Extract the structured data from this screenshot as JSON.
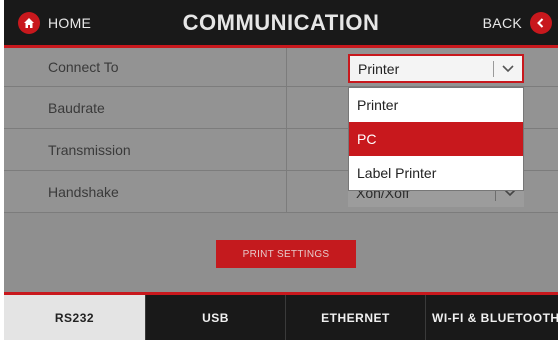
{
  "header": {
    "home_label": "HOME",
    "title": "COMMUNICATION",
    "back_label": "BACK"
  },
  "settings": [
    {
      "label": "Connect To",
      "value": "Printer"
    },
    {
      "label": "Baudrate",
      "value": ""
    },
    {
      "label": "Transmission",
      "value": ""
    },
    {
      "label": "Handshake",
      "value": "Xon/Xoff"
    }
  ],
  "dropdown": {
    "options": [
      "Printer",
      "PC",
      "Label Printer"
    ],
    "highlighted": "PC"
  },
  "print_settings_label": "PRINT SETTINGS",
  "tabs": [
    {
      "label": "RS232",
      "active": true
    },
    {
      "label": "USB",
      "active": false
    },
    {
      "label": "ETHERNET",
      "active": false
    },
    {
      "label": "WI-FI & BLUETOOTH",
      "active": false
    }
  ],
  "colors": {
    "accent": "#c8181d",
    "header_bg": "#191919",
    "panel_bg": "#939393"
  },
  "icons": {
    "home": "home-icon",
    "back": "back-arrow-icon",
    "dropdown": "chevron-down-icon"
  }
}
